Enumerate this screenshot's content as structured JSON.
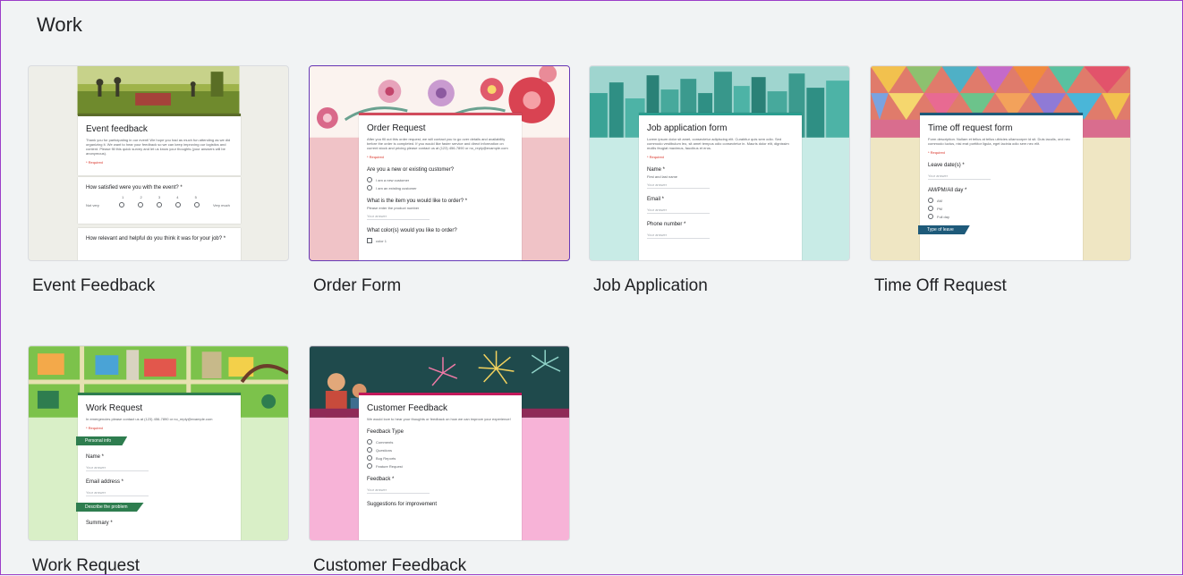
{
  "section": {
    "title": "Work"
  },
  "templates": [
    {
      "label": "Event Feedback",
      "form_title": "Event feedback",
      "desc": "Thank you for participating in our event! We hope you had as much fun attending as we did organizing it. We want to hear your feedback so we can keep improving our logistics and content. Please fill this quick survey and let us know your thoughts (your answers will be anonymous).",
      "required": "* Required",
      "q1": "How satisfied were you with the event? *",
      "scale_low": "Not very",
      "scale_high": "Very much",
      "scale": [
        "1",
        "2",
        "3",
        "4",
        "5"
      ],
      "q2": "How relevant and helpful do you think it was for your job? *"
    },
    {
      "label": "Order Form",
      "form_title": "Order Request",
      "desc": "After you fill out this order request, we will contact you to go over details and availability before the order is completed. If you would like faster service and direct information on current stock and pricing please contact us at (123) 456-7890 or no_reply@example.com",
      "required": "* Required",
      "q1": "Are you a new or existing customer?",
      "opt1": "I am a new customer",
      "opt2": "I am an existing customer",
      "q2": "What is the item you would like to order? *",
      "q2_sub": "Please enter the product number",
      "answer_placeholder": "Your answer",
      "q3": "What color(s) would you like to order?",
      "color_opt": "color 1"
    },
    {
      "label": "Job Application",
      "form_title": "Job application form",
      "desc": "Lorem ipsum dolor sit amet, consectetur adipiscing elit. Curabitur quis sem odio. Sed commodo vestibulum leo, sit amet tempus odio consectetur in. Mauris dolor elit, dignissim mollis feugiat maximus, faucibus et eros.",
      "required": "* Required",
      "q1": "Name *",
      "q1_sub": "First and last name",
      "q2": "Email *",
      "q3": "Phone number *",
      "answer_placeholder": "Your answer"
    },
    {
      "label": "Time Off Request",
      "form_title": "Time off request form",
      "desc": "Form description. Nullam et tellus at tellus ultricies ullamcorper id sit. Duis iaculis, orci nec commodo luctus, nisi erat porttitor ligula, eget lacinia odio sem nec elit.",
      "required": "* Required",
      "q1": "Leave date(s) *",
      "answer_placeholder": "Your answer",
      "q2": "AM/PM/All day *",
      "opt1": "AM",
      "opt2": "PM",
      "opt3": "Full day",
      "section": "Type of leave"
    },
    {
      "label": "Work Request",
      "form_title": "Work Request",
      "desc": "In emergencies please contact us at (123) 456-7890 or no_reply@example.com",
      "required": "* Required",
      "section1": "Personal info",
      "q1": "Name *",
      "q2": "Email address *",
      "answer_placeholder": "Your answer",
      "section2": "Describe the problem",
      "q3": "Summary *"
    },
    {
      "label": "Customer Feedback",
      "form_title": "Customer Feedback",
      "desc": "We would love to hear your thoughts or feedback on how we can improve your experience!",
      "q1": "Feedback Type",
      "opt1": "Comments",
      "opt2": "Questions",
      "opt3": "Bug Reports",
      "opt4": "Feature Request",
      "q2": "Feedback *",
      "answer_placeholder": "Your answer",
      "q3": "Suggestions for improvement"
    }
  ],
  "colors": {
    "page_bg": "#f1f3f4",
    "selected_border": "#673ab7",
    "order_accent": "#d14b5c",
    "job_accent": "#2a9d8f",
    "timeoff_accent": "#1e5a7a",
    "work_accent": "#2e7d4f",
    "customer_accent": "#c2185b"
  }
}
